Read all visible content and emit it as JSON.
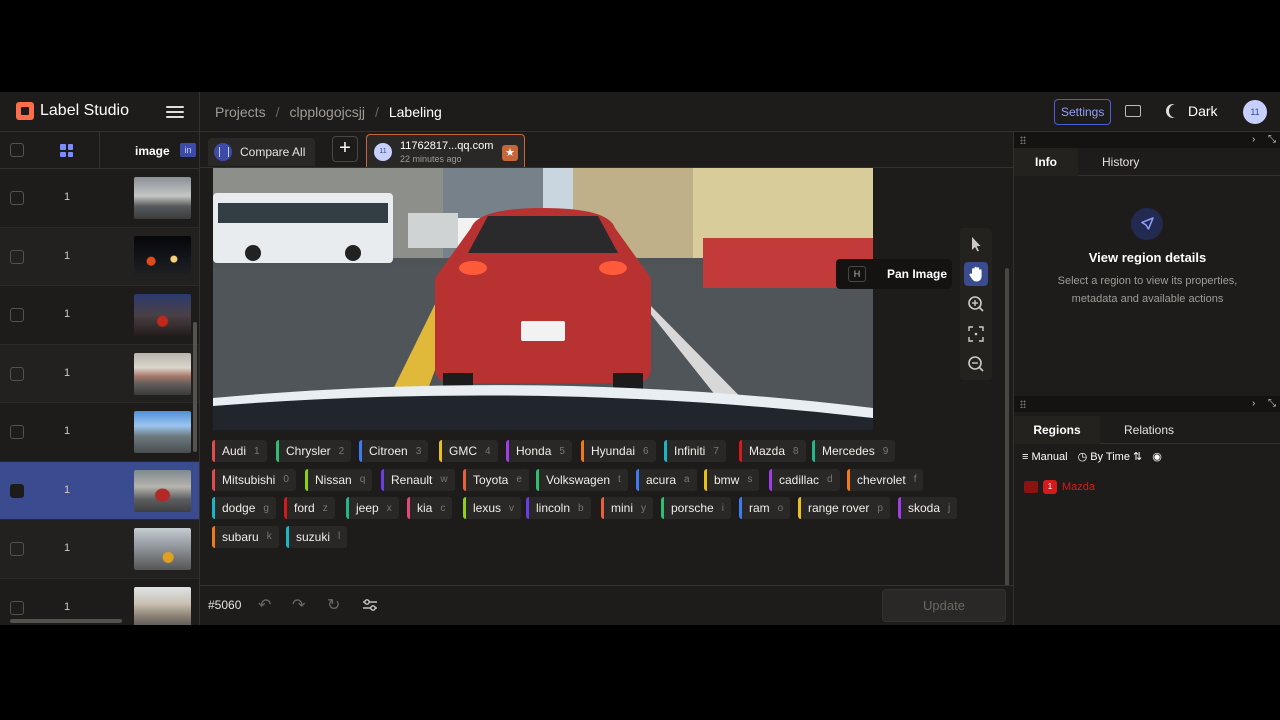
{
  "app": {
    "brand": "Label Studio",
    "breadcrumb": [
      "Projects",
      "clpplogojcsjj",
      "Labeling"
    ],
    "settings_label": "Settings",
    "theme_label": "Dark",
    "user_initials": "11"
  },
  "table": {
    "column_image": "image",
    "info_badge": "in",
    "rows": [
      {
        "id": "1"
      },
      {
        "id": "1"
      },
      {
        "id": "1"
      },
      {
        "id": "1"
      },
      {
        "id": "1"
      },
      {
        "id": "1"
      },
      {
        "id": "1"
      },
      {
        "id": "1"
      }
    ],
    "selected_row": 5
  },
  "annotation": {
    "compare_label": "Compare All",
    "tab_email": "11762817...qq.com",
    "tab_time": "22 minutes ago",
    "tab_avatar": "11"
  },
  "tooltip": {
    "key": "H",
    "text": "Pan Image"
  },
  "labels": [
    {
      "name": "Audi",
      "key": "1",
      "color": "#e04b4b"
    },
    {
      "name": "Chrysler",
      "key": "2",
      "color": "#2fbf71"
    },
    {
      "name": "Citroen",
      "key": "3",
      "color": "#3d7cf0"
    },
    {
      "name": "GMC",
      "key": "4",
      "color": "#e8c21b"
    },
    {
      "name": "Honda",
      "key": "5",
      "color": "#a13ce8"
    },
    {
      "name": "Hyundai",
      "key": "6",
      "color": "#f07a1a"
    },
    {
      "name": "Infiniti",
      "key": "7",
      "color": "#18b7c7"
    },
    {
      "name": "Mazda",
      "key": "8",
      "color": "#d41a1a"
    },
    {
      "name": "Mercedes",
      "key": "9",
      "color": "#1fb88a"
    },
    {
      "name": "Mitsubishi",
      "key": "0",
      "color": "#e04b4b"
    },
    {
      "name": "Nissan",
      "key": "q",
      "color": "#8bd11a"
    },
    {
      "name": "Renault",
      "key": "w",
      "color": "#6b3ce8"
    },
    {
      "name": "Toyota",
      "key": "e",
      "color": "#e8613c"
    },
    {
      "name": "Volkswagen",
      "key": "t",
      "color": "#2fbf71"
    },
    {
      "name": "acura",
      "key": "a",
      "color": "#3d7cf0"
    },
    {
      "name": "bmw",
      "key": "s",
      "color": "#e8c21b"
    },
    {
      "name": "cadillac",
      "key": "d",
      "color": "#a13ce8"
    },
    {
      "name": "chevrolet",
      "key": "f",
      "color": "#f07a1a"
    },
    {
      "name": "dodge",
      "key": "g",
      "color": "#18b7c7"
    },
    {
      "name": "ford",
      "key": "z",
      "color": "#d41a1a"
    },
    {
      "name": "jeep",
      "key": "x",
      "color": "#1fb88a"
    },
    {
      "name": "kia",
      "key": "c",
      "color": "#e04b7c"
    },
    {
      "name": "lexus",
      "key": "v",
      "color": "#8bd11a"
    },
    {
      "name": "lincoln",
      "key": "b",
      "color": "#6b3ce8"
    },
    {
      "name": "mini",
      "key": "y",
      "color": "#e8613c"
    },
    {
      "name": "porsche",
      "key": "i",
      "color": "#2fbf71"
    },
    {
      "name": "ram",
      "key": "o",
      "color": "#3d7cf0"
    },
    {
      "name": "range rover",
      "key": "p",
      "color": "#e8c21b"
    },
    {
      "name": "skoda",
      "key": "j",
      "color": "#a13ce8"
    },
    {
      "name": "subaru",
      "key": "k",
      "color": "#f07a1a"
    },
    {
      "name": "suzuki",
      "key": "l",
      "color": "#18b7c7"
    }
  ],
  "bottom": {
    "task_id": "#5060",
    "update_label": "Update"
  },
  "right": {
    "tabs_top": [
      "Info",
      "History"
    ],
    "view_title": "View region details",
    "view_desc": "Select a region to view its properties, metadata and available actions",
    "tabs_bottom": [
      "Regions",
      "Relations"
    ],
    "filter_manual": "Manual",
    "filter_sort": "By Time",
    "region": {
      "index": "1",
      "name": "Mazda"
    }
  }
}
